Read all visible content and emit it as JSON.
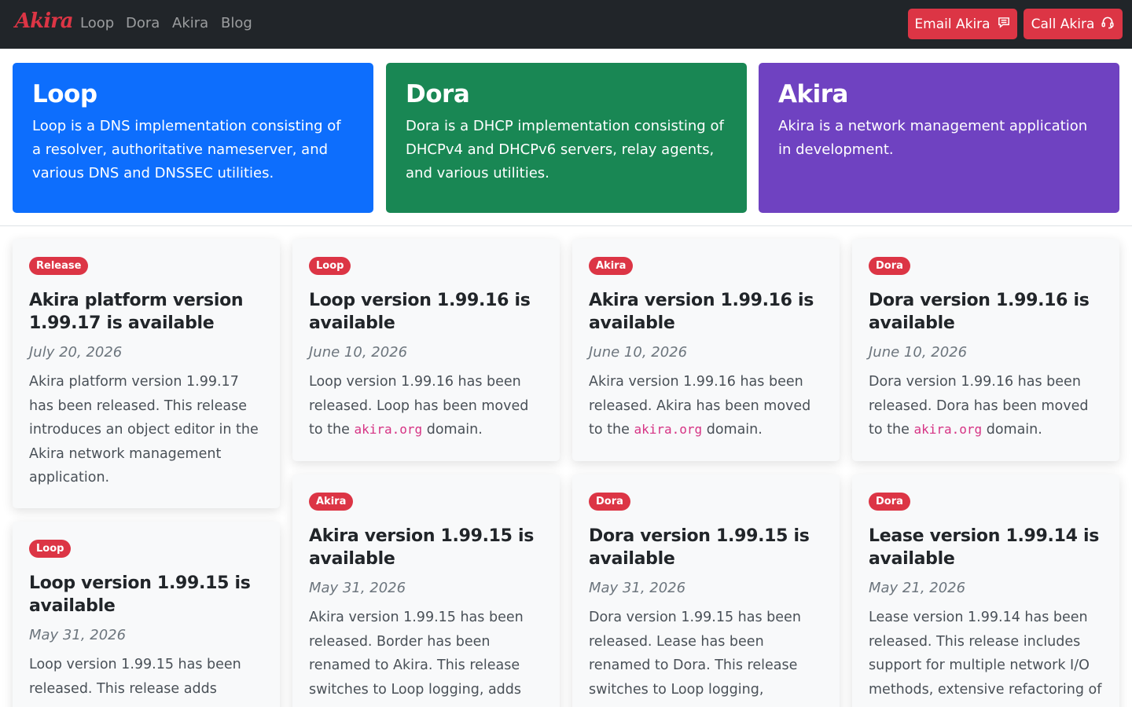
{
  "nav": {
    "brand": "Akira",
    "links": [
      "Loop",
      "Dora",
      "Akira",
      "Blog"
    ],
    "email_button": "Email Akira",
    "call_button": "Call Akira"
  },
  "heroes": [
    {
      "title": "Loop",
      "text": "Loop is a DNS implementation consisting of a resolver, authoritative nameserver, and various DNS and DNSSEC utilities.",
      "color": "#0d6efd"
    },
    {
      "title": "Dora",
      "text": "Dora is a DHCP implementation consisting of DHCPv4 and DHCPv6 servers, relay agents, and various utilities.",
      "color": "#198754"
    },
    {
      "title": "Akira",
      "text": "Akira is a network management application in development.",
      "color": "#6f42c1"
    }
  ],
  "posts": [
    {
      "badge": "Release",
      "title": "Akira platform version 1.99.17 is available",
      "date": "July 20, 2026",
      "body": "Akira platform version 1.99.17 has been released. This release introduces an object editor in the Akira network management application."
    },
    {
      "badge": "Loop",
      "title": "Loop version 1.99.16 is available",
      "date": "June 10, 2026",
      "body_pre": "Loop version 1.99.16 has been released. Loop has been moved to the",
      "code": "akira.org",
      "body_post": "domain."
    },
    {
      "badge": "Akira",
      "title": "Akira version 1.99.16 is available",
      "date": "June 10, 2026",
      "body_pre": "Akira version 1.99.16 has been released. Akira has been moved to the",
      "code": "akira.org",
      "body_post": "domain."
    },
    {
      "badge": "Dora",
      "title": "Dora version 1.99.16 is available",
      "date": "June 10, 2026",
      "body_pre": "Dora version 1.99.16 has been released. Dora has been moved to the",
      "code": "akira.org",
      "body_post": "domain."
    },
    {
      "badge": "Loop",
      "title": "Loop version 1.99.15 is available",
      "date": "May 31, 2026",
      "body": "Loop version 1.99.15 has been released. This release adds"
    },
    {
      "badge": "Akira",
      "title": "Akira version 1.99.15 is available",
      "date": "May 31, 2026",
      "body": "Akira version 1.99.15 has been released. Border has been renamed to Akira. This release switches to Loop logging, adds"
    },
    {
      "badge": "Dora",
      "title": "Dora version 1.99.15 is available",
      "date": "May 31, 2026",
      "body": "Dora version 1.99.15 has been released. Lease has been renamed to Dora. This release switches to Loop logging,"
    },
    {
      "badge": "Dora",
      "title": "Lease version 1.99.14 is available",
      "date": "May 21, 2026",
      "body": "Lease version 1.99.14 has been released. This release includes support for multiple network I/O methods, extensive refactoring of"
    }
  ]
}
